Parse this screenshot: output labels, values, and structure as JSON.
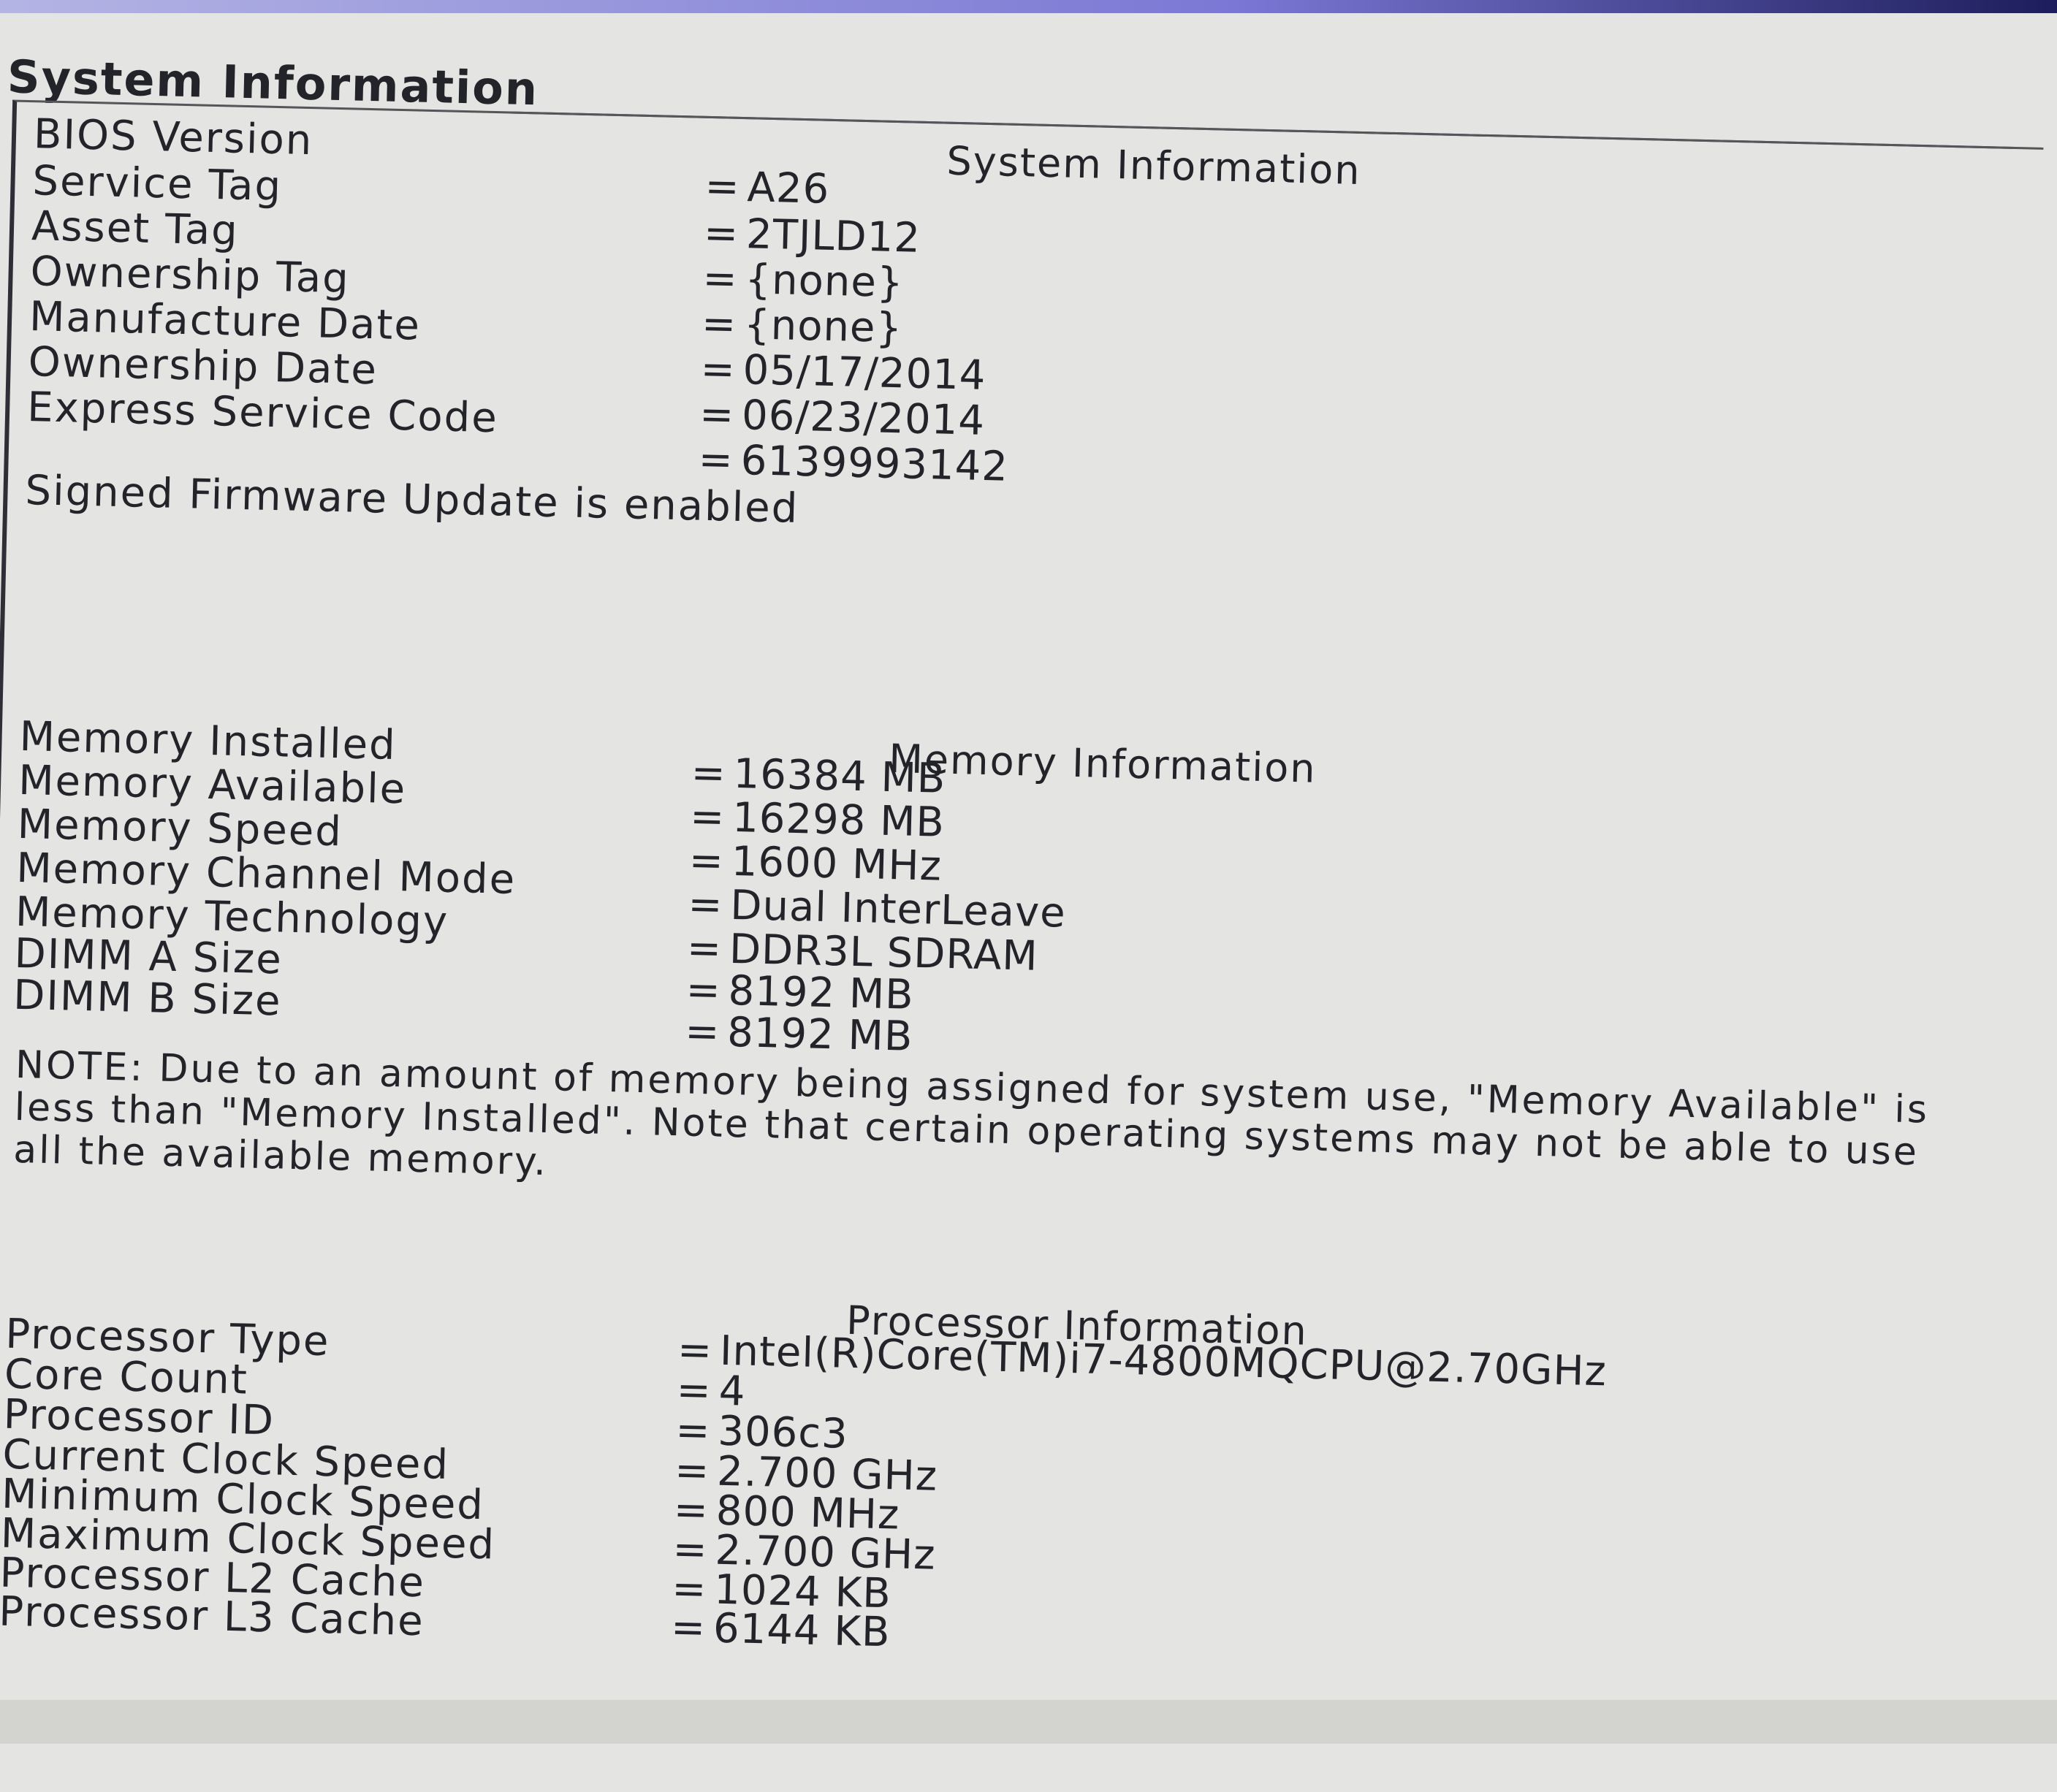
{
  "section_title": "System Information",
  "system": {
    "heading": "System Information",
    "rows": [
      {
        "label": "BIOS Version",
        "value": "A26"
      },
      {
        "label": "Service Tag",
        "value": "2TJLD12"
      },
      {
        "label": "Asset Tag",
        "value": "{none}"
      },
      {
        "label": "Ownership Tag",
        "value": "{none}"
      },
      {
        "label": "Manufacture Date",
        "value": "05/17/2014"
      },
      {
        "label": "Ownership Date",
        "value": "06/23/2014"
      },
      {
        "label": "Express Service Code",
        "value": "6139993142"
      }
    ],
    "firmware_status": "Signed Firmware Update is enabled"
  },
  "memory": {
    "heading": "Memory Information",
    "rows": [
      {
        "label": "Memory Installed",
        "value": "16384 MB"
      },
      {
        "label": "Memory Available",
        "value": "16298 MB"
      },
      {
        "label": "Memory Speed",
        "value": "1600 MHz"
      },
      {
        "label": "Memory Channel Mode",
        "value": "Dual InterLeave"
      },
      {
        "label": "Memory Technology",
        "value": "DDR3L SDRAM"
      },
      {
        "label": "DIMM A Size",
        "value": "8192 MB"
      },
      {
        "label": "DIMM B Size",
        "value": "8192 MB"
      }
    ],
    "note": "NOTE: Due to an amount of memory being assigned for system use, \"Memory Available\" is less than \"Memory Installed\". Note that certain operating systems may not be able to use all the available memory."
  },
  "processor": {
    "heading": "Processor Information",
    "rows": [
      {
        "label": "Processor Type",
        "value": "Intel(R)Core(TM)i7-4800MQCPU@2.70GHz"
      },
      {
        "label": "Core Count",
        "value": "4"
      },
      {
        "label": "Processor ID",
        "value": "306c3"
      },
      {
        "label": "Current Clock Speed",
        "value": "2.700 GHz"
      },
      {
        "label": "Minimum Clock Speed",
        "value": "800 MHz"
      },
      {
        "label": "Maximum Clock Speed",
        "value": "2.700 GHz"
      },
      {
        "label": "Processor L2 Cache",
        "value": "1024 KB"
      },
      {
        "label": "Processor L3 Cache",
        "value": "6144 KB"
      }
    ]
  },
  "equals_sign": "="
}
